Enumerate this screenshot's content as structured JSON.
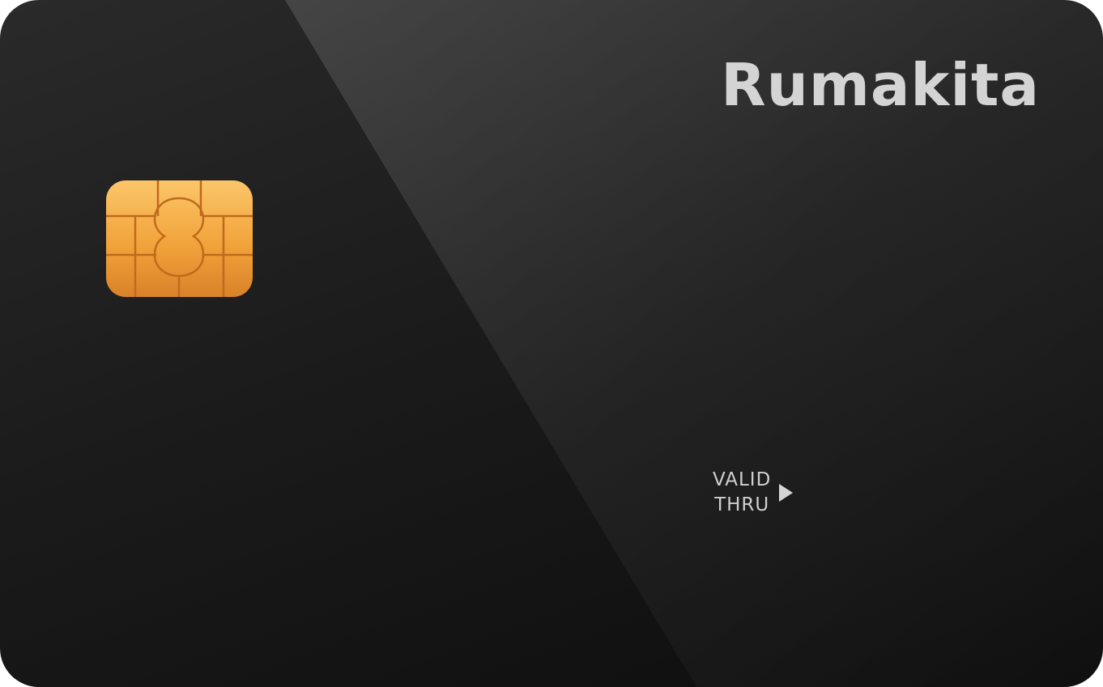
{
  "card": {
    "brand": "Rumakita",
    "valid_line1": "VALID",
    "valid_line2": "THRU",
    "chip_icon": "emv-chip-icon",
    "arrow_icon": "triangle-right-icon",
    "colors": {
      "card_dark": "#0d0d0d",
      "card_light": "#3a3a3a",
      "text": "#d4d4d4",
      "chip_gold": "#f0a030"
    }
  }
}
